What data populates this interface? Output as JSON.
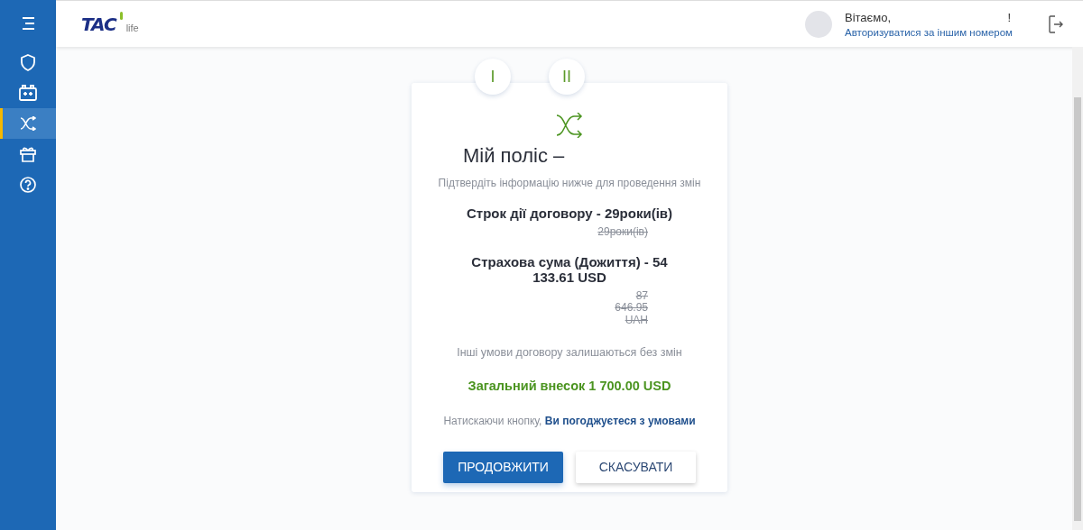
{
  "sidebar": {
    "items": [
      {
        "kind": "menu",
        "selected": false
      },
      {
        "kind": "shield",
        "selected": false
      },
      {
        "kind": "battery",
        "selected": false
      },
      {
        "kind": "shuffle",
        "selected": true
      },
      {
        "kind": "gift",
        "selected": false
      },
      {
        "kind": "help",
        "selected": false
      }
    ]
  },
  "header": {
    "logo": {
      "name": "TAC",
      "suffix": "life"
    },
    "greeting": "Вітаємо,",
    "greeting_end": "!",
    "switch_link": "Авторизуватися за іншим номером"
  },
  "steps": [
    "I",
    "II"
  ],
  "card": {
    "title": "Мій поліс –",
    "subtitle": "Підтвердіть інформацію нижче для проведення змін",
    "changes": [
      {
        "label": "Строк дії договору - 29роки(ів)",
        "old": "29роки(ів)"
      },
      {
        "label": "Страхова сума (Дожиття) - 54 133.61 USD",
        "old": "87 646.95 UAH"
      }
    ],
    "note": "Інші умови договору залишаються без змін",
    "total": "Загальний внесок 1 700.00 USD",
    "consent": "Натискаючи кнопку,",
    "consent_link": "Ви погоджуєтеся з умовами",
    "buttons": [
      {
        "label": "ПРОДОВЖИТИ",
        "kind": "primary"
      },
      {
        "label": "СКАСУВАТИ",
        "kind": "secondary"
      }
    ]
  }
}
